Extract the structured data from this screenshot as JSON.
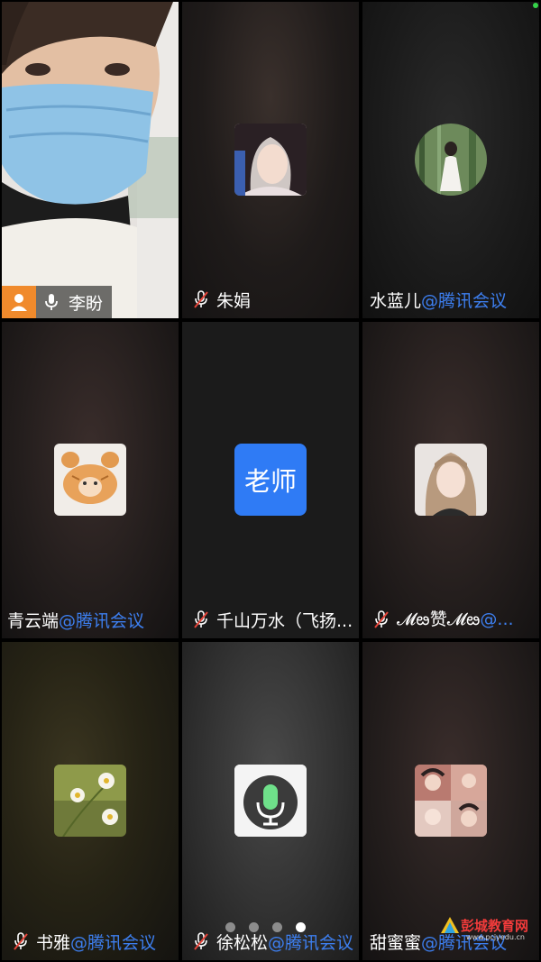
{
  "self_tile": {
    "name": "李盼",
    "host_icon": "user-icon",
    "mic_icon": "mic-icon"
  },
  "participants": [
    {
      "name": "朱娟",
      "suffix": "",
      "mic": "mic-muted-icon"
    },
    {
      "name": "水蓝儿",
      "suffix": "@腾讯会议",
      "mic": "none"
    },
    {
      "name": "青云端",
      "suffix": "@腾讯会议",
      "mic": "none"
    },
    {
      "name": "千山万水（飞扬...",
      "suffix": "",
      "mic": "mic-muted-icon",
      "avatar_text": "老师"
    },
    {
      "name": "𝓜ఴ赞𝓜ఴ",
      "suffix": "@...",
      "mic": "mic-muted-icon"
    },
    {
      "name": "书雅",
      "suffix": "@腾讯会议",
      "mic": "mic-muted-icon"
    },
    {
      "name": "徐松松",
      "suffix": "@腾讯会议",
      "mic": "mic-muted-icon"
    },
    {
      "name": "甜蜜蜜",
      "suffix": "@腾讯会议",
      "mic": "none"
    }
  ],
  "pagination": {
    "total": 4,
    "active": 4
  },
  "watermark": {
    "text": "彭城教育网",
    "url": "www.pcjyedu.cn"
  },
  "colors": {
    "teacher_avatar": "#2f7bf5",
    "host_badge": "#f08a2c",
    "suffix": "#3d7ff0",
    "status_dot": "#35d34a"
  }
}
